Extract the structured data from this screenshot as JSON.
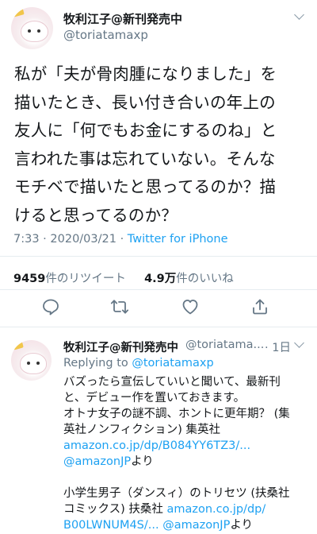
{
  "main_tweet": {
    "display_name": "牧利江子@新刊発売中",
    "handle": "@toriatamaxp",
    "text_lines": [
      "私が「夫が骨肉腫になりました」を",
      "描いたとき、長い付き合いの年上の",
      "友人に「何でもお金にするのね」と",
      "言われた事は忘れていない。そんな",
      "モチベで描いたと思ってるのか？描",
      "けると思ってるのか？"
    ],
    "time": "7:33 · 2020/03/21 · ",
    "source": "Twitter for iPhone",
    "retweet_count": "9459",
    "retweet_label": "件のリツイート",
    "like_count": "4.9万",
    "like_label": "件のいいね",
    "avatar_tag": "田"
  },
  "actions": [
    "reply-icon",
    "retweet-icon",
    "like-icon",
    "share-icon"
  ],
  "reply_tweet": {
    "display_name": "牧利江子@新刊発売中",
    "handle": "@toriatama...",
    "age": "· 1日",
    "replying_prefix": "Replying to ",
    "replying_to": "@toriatamaxp",
    "lines": [
      "バズったら宣伝していいと聞いて、最新刊",
      "と、デビュー作を置いておきます。",
      "オトナ女子の謎不調、ホントに更年期？ (集",
      "英社ノンフィクション) 集英社"
    ],
    "link1": "amazon.co.jp/dp/B084YY6TZ3/...",
    "link1_mention": "@amazonJP",
    "link1_suffix": "より",
    "line_book2_a": "小学生男子（ダンスィ）のトリセツ (扶桑社",
    "line_book2_b_text": "コミックス) 扶桑社 ",
    "link2a": "amazon.co.jp/dp/",
    "link2b": "B00LWNUM4S/...",
    "link2_mention": "@amazonJP",
    "link2_suffix": "より"
  },
  "colors": {
    "text": "#14171a",
    "secondary": "#657786",
    "link": "#1da1f2",
    "divider": "#e6ecf0"
  }
}
